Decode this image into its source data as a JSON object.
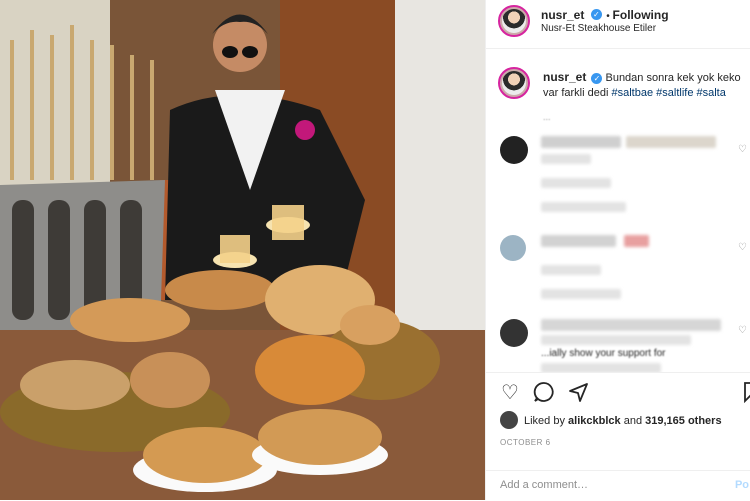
{
  "header": {
    "username": "nusr_et",
    "follow_status": "Following",
    "location": "Nusr-Et Steakhouse Etiler"
  },
  "caption": {
    "username": "nusr_et",
    "text": "Bundan sonra kek yok keko var farkli dedi",
    "hashtags": [
      "#saltbae",
      "#saltlife",
      "#salta"
    ]
  },
  "comment_preview": "...",
  "last_comment_text": "...ially show your support for",
  "likes": {
    "prefix": "Liked by",
    "user": "alikckblck",
    "connector": "and",
    "count": "319,165 others"
  },
  "date": "OCTOBER 6",
  "add_comment": {
    "placeholder": "Add a comment…",
    "post_label": "Po"
  },
  "icons": {
    "verified": "verified-badge-icon",
    "like": "heart-icon",
    "comment": "comment-bubble-icon",
    "share": "share-arrow-icon",
    "comment_like": "small-heart-icon"
  },
  "colors": {
    "accent": "#3897f0",
    "hashtag": "#00376b",
    "ring": "#d6249f"
  }
}
